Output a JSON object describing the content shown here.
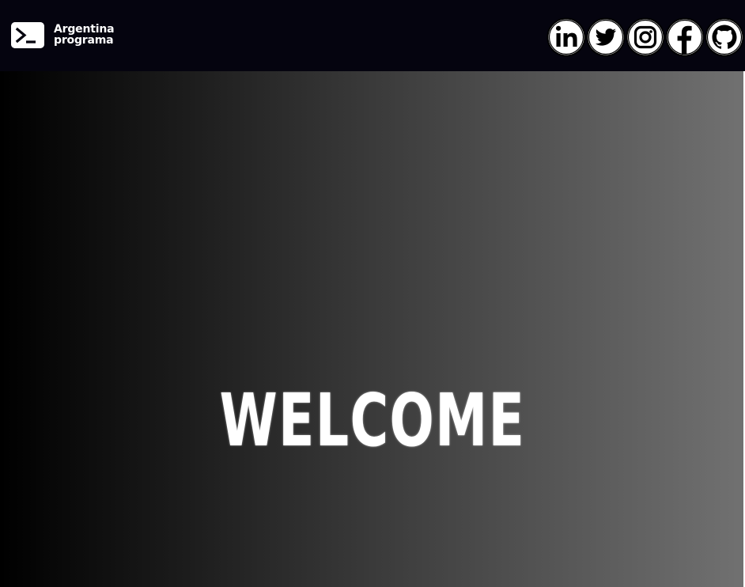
{
  "header": {
    "logo": {
      "line1": "Argentina",
      "line2": "programa",
      "icon": "terminal-prompt-icon"
    },
    "social_links": [
      {
        "name": "linkedin",
        "icon": "linkedin-icon"
      },
      {
        "name": "twitter",
        "icon": "twitter-icon"
      },
      {
        "name": "instagram",
        "icon": "instagram-icon"
      },
      {
        "name": "facebook",
        "icon": "facebook-icon"
      },
      {
        "name": "github",
        "icon": "github-icon"
      }
    ]
  },
  "hero": {
    "title": "WELCOME",
    "gradient": [
      "#000000",
      "#717171"
    ]
  },
  "colors": {
    "header_bg": "#05040f",
    "text": "#ffffff"
  }
}
